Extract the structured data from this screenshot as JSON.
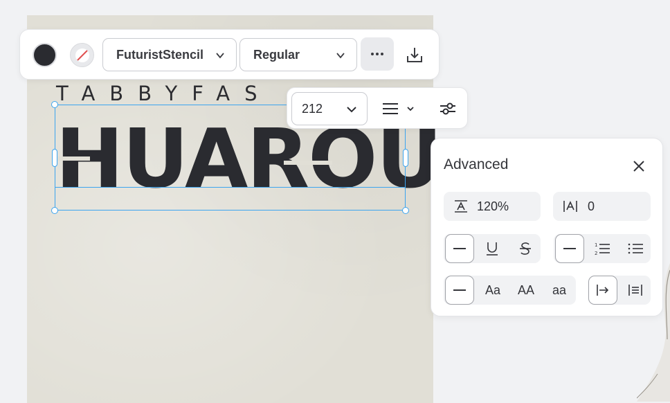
{
  "canvas": {
    "subtitle": "TABBYFAS",
    "headline": "HUAROU"
  },
  "toolbar": {
    "text_color": "#2a2b30",
    "font_family": "FuturistStencil",
    "font_weight": "Regular",
    "more_icon": "ellipsis-icon",
    "download_icon": "download-icon"
  },
  "subbar": {
    "font_size": "212",
    "align_icon": "align-justify-icon",
    "settings_icon": "sliders-icon"
  },
  "advanced": {
    "title": "Advanced",
    "line_height": "120%",
    "letter_spacing": "0",
    "decoration_options": [
      "none",
      "underline",
      "strikethrough"
    ],
    "list_options": [
      "none",
      "ordered-list",
      "unordered-list"
    ],
    "case_options": [
      "none",
      "Aa",
      "AA",
      "aa"
    ],
    "direction_options": [
      "indent",
      "align"
    ]
  },
  "colors": {
    "selection": "#3ba4ef",
    "canvas_bg": "#e1dfd6"
  }
}
